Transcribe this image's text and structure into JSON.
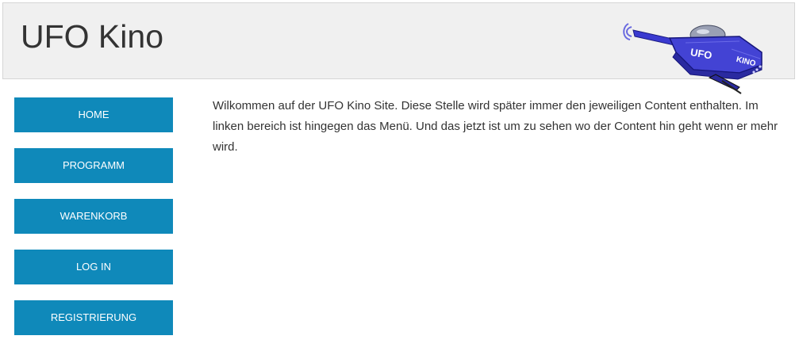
{
  "header": {
    "site_title": "UFO Kino",
    "logo": {
      "icon": "ufo-logo-icon",
      "text_left": "UFO",
      "text_right": "KINO"
    }
  },
  "nav": {
    "items": [
      {
        "label": "HOME"
      },
      {
        "label": "PROGRAMM"
      },
      {
        "label": "WARENKORB"
      },
      {
        "label": "LOG IN"
      },
      {
        "label": "REGISTRIERUNG"
      }
    ]
  },
  "main": {
    "paragraph": "Wilkommen auf der UFO Kino Site. Diese Stelle wird später immer den jeweiligen Content enthalten. Im linken bereich ist hingegen das Menü. Und das jetzt ist um zu sehen wo der Content hin geht wenn er mehr wird."
  },
  "colors": {
    "header_background": "#f0f0f0",
    "nav_button": "#0f89ba",
    "text": "#333333",
    "logo_blue": "#3f3fc8"
  }
}
